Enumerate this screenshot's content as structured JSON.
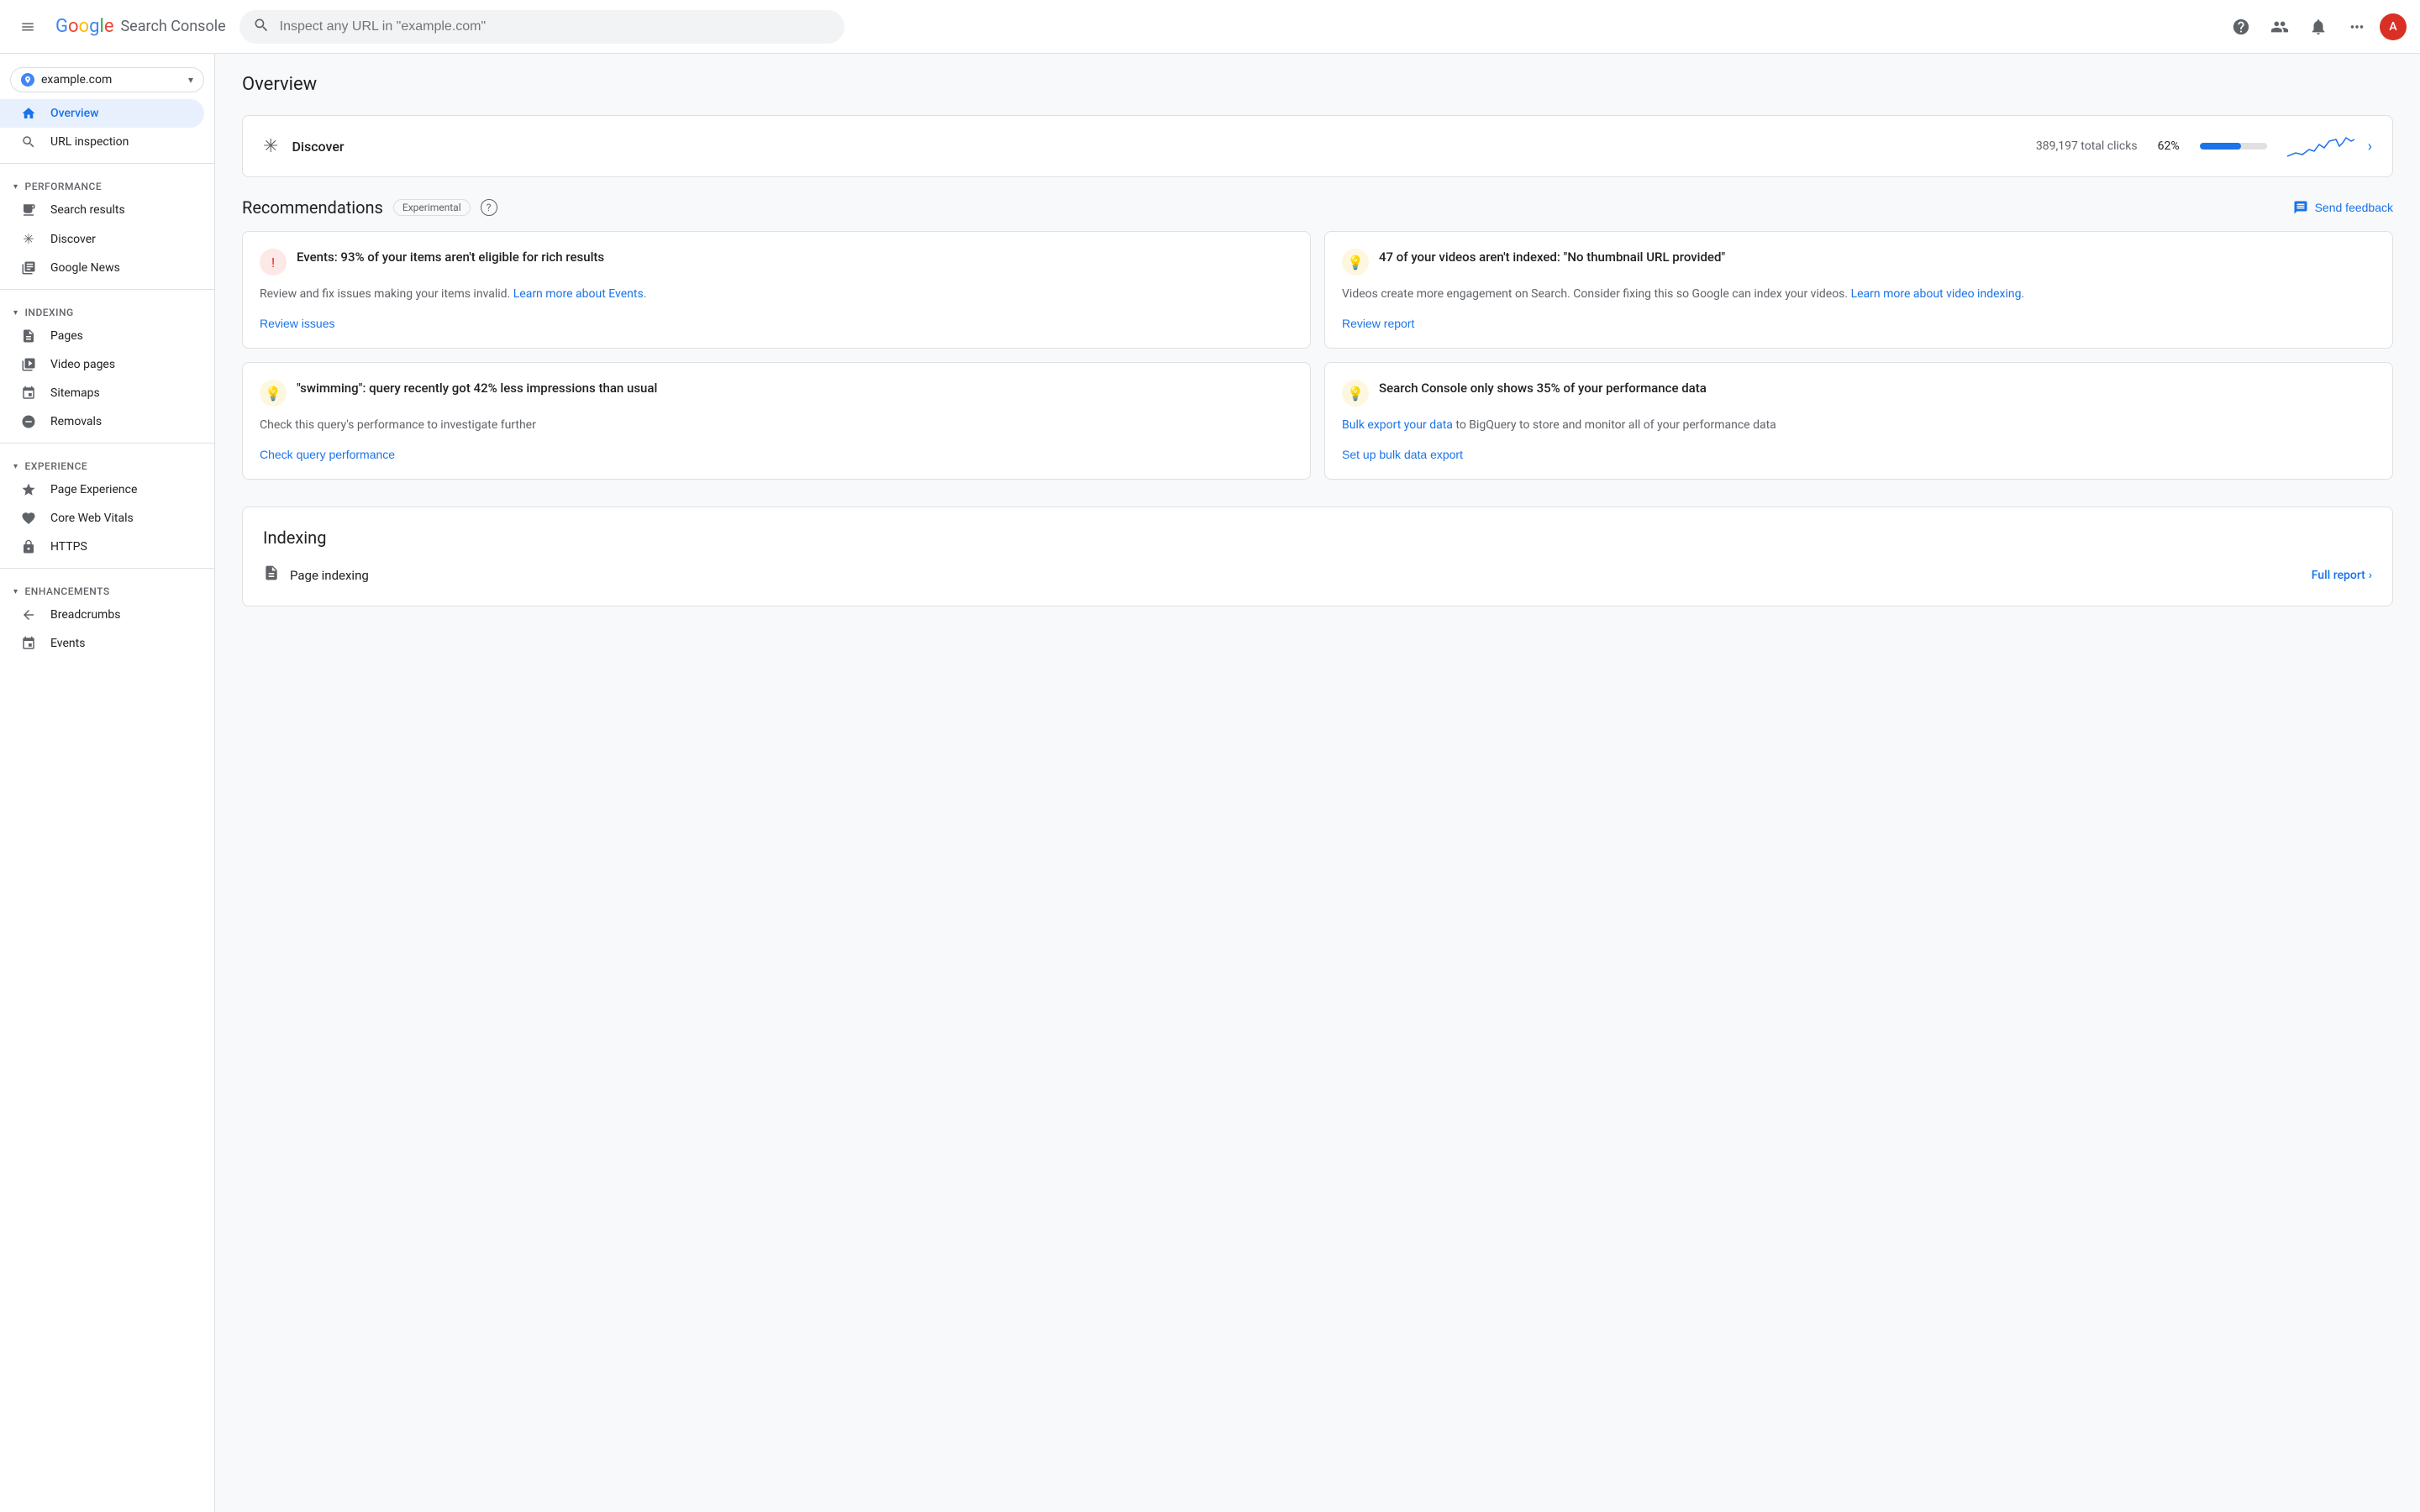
{
  "app": {
    "title": "Search Console",
    "google_logo": "Google"
  },
  "topbar": {
    "search_placeholder": "Inspect any URL in \"example.com\"",
    "help_label": "Help",
    "manage_users_label": "Manage users",
    "notifications_label": "Notifications",
    "apps_label": "Google apps",
    "account_label": "Account"
  },
  "property_selector": {
    "name": "example.com",
    "dropdown_label": "Select property"
  },
  "sidebar": {
    "overview_label": "Overview",
    "url_inspection_label": "URL inspection",
    "performance_section": "Performance",
    "search_results_label": "Search results",
    "discover_label": "Discover",
    "google_news_label": "Google News",
    "indexing_section": "Indexing",
    "pages_label": "Pages",
    "video_pages_label": "Video pages",
    "sitemaps_label": "Sitemaps",
    "removals_label": "Removals",
    "experience_section": "Experience",
    "page_experience_label": "Page Experience",
    "core_web_vitals_label": "Core Web Vitals",
    "https_label": "HTTPS",
    "enhancements_section": "Enhancements",
    "breadcrumbs_label": "Breadcrumbs",
    "events_label": "Events"
  },
  "main": {
    "page_title": "Overview"
  },
  "discover_card": {
    "icon": "asterisk",
    "name": "Discover",
    "clicks": "389,197 total clicks",
    "pct": "62%",
    "progress_fill_pct": 62
  },
  "recommendations": {
    "title": "Recommendations",
    "badge": "Experimental",
    "send_feedback_label": "Send feedback",
    "cards": [
      {
        "icon_type": "error",
        "title": "Events: 93% of your items aren't eligible for rich results",
        "body": "Review and fix issues making your items invalid.",
        "link_text": "Learn more about Events",
        "action_label": "Review issues"
      },
      {
        "icon_type": "warning",
        "title": "47 of your videos aren't indexed: \"No thumbnail URL provided\"",
        "body": "Videos create more engagement on Search. Consider fixing this so Google can index your videos.",
        "link_text": "Learn more about video indexing",
        "action_label": "Review report"
      },
      {
        "icon_type": "warning",
        "title": "\"swimming\": query recently got 42% less impressions than usual",
        "body": "Check this query's performance to investigate further",
        "link_text": "",
        "action_label": "Check query performance"
      },
      {
        "icon_type": "warning",
        "title": "Search Console only shows 35% of your performance data",
        "body": "to BigQuery to store and monitor all of your performance data",
        "link_text": "Bulk export your data",
        "action_label": "Set up bulk data export"
      }
    ]
  },
  "indexing": {
    "title": "Indexing",
    "page_indexing_label": "Page indexing",
    "full_report_label": "Full report"
  }
}
